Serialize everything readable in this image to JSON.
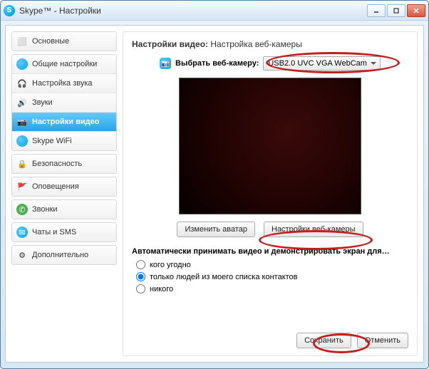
{
  "window": {
    "title": "Skype™ - Настройки"
  },
  "sidebar": {
    "groups": [
      {
        "items": [
          {
            "label": "Основные",
            "icon": "general-icon"
          }
        ]
      },
      {
        "items": [
          {
            "label": "Общие настройки",
            "icon": "skype-icon"
          },
          {
            "label": "Настройка звука",
            "icon": "headset-icon"
          },
          {
            "label": "Звуки",
            "icon": "speaker-icon"
          },
          {
            "label": "Настройки видео",
            "icon": "camera-icon",
            "selected": true
          },
          {
            "label": "Skype WiFi",
            "icon": "wifi-icon"
          }
        ]
      },
      {
        "items": [
          {
            "label": "Безопасность",
            "icon": "lock-icon"
          }
        ]
      },
      {
        "items": [
          {
            "label": "Оповещения",
            "icon": "flag-icon"
          }
        ]
      },
      {
        "items": [
          {
            "label": "Звонки",
            "icon": "phone-icon"
          }
        ]
      },
      {
        "items": [
          {
            "label": "Чаты и SMS",
            "icon": "chat-icon"
          }
        ]
      },
      {
        "items": [
          {
            "label": "Дополнительно",
            "icon": "gear-icon"
          }
        ]
      }
    ]
  },
  "content": {
    "header_bold": "Настройки видео:",
    "header_rest": "Настройка веб-камеры",
    "select_label": "Выбрать веб-камеру:",
    "camera_selected": "USB2.0 UVC VGA WebCam",
    "btn_avatar": "Изменить аватар",
    "btn_cam_settings": "Настройки веб-камеры",
    "auto_heading": "Автоматически принимать видео и демонстрировать экран для…",
    "radio_anyone": "кого угодно",
    "radio_contacts": "только людей из моего списка контактов",
    "radio_noone": "никого",
    "radio_selected": "contacts"
  },
  "footer": {
    "save": "Сохранить",
    "cancel": "Отменить"
  },
  "icons": {
    "general-icon": "⬜",
    "skype-icon": "🟦",
    "headset-icon": "🎧",
    "speaker-icon": "🔊",
    "camera-icon": "📷",
    "wifi-icon": "📶",
    "lock-icon": "🔒",
    "flag-icon": "🚩",
    "phone-icon": "📞",
    "chat-icon": "💬",
    "gear-icon": "⚙️"
  }
}
